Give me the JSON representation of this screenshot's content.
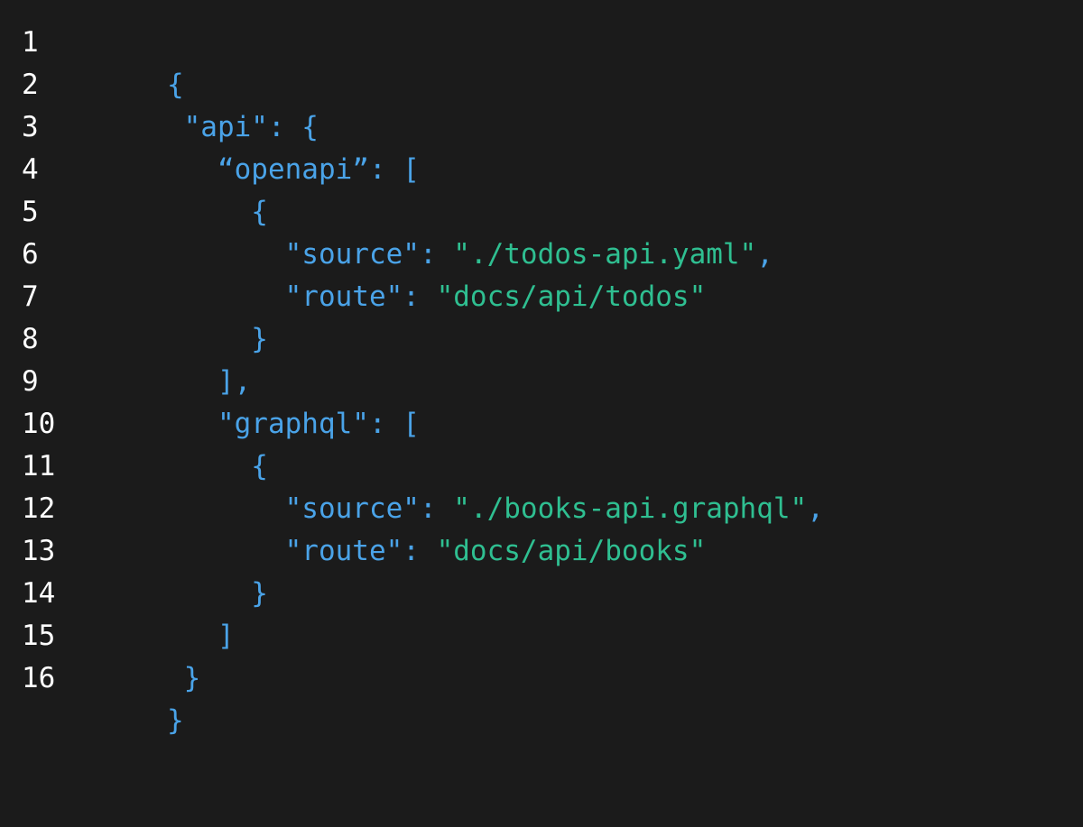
{
  "colors": {
    "background": "#1b1b1b",
    "line_number": "#ffffff",
    "key": "#4aa3e8",
    "punct": "#4aa3e8",
    "string": "#2fbf91"
  },
  "editor": {
    "lines": [
      {
        "number": "1",
        "tokens": [
          {
            "text": "{",
            "kind": "punct"
          }
        ]
      },
      {
        "number": "2",
        "tokens": [
          {
            "text": " \"api\"",
            "kind": "key"
          },
          {
            "text": ": {",
            "kind": "punct"
          }
        ]
      },
      {
        "number": "3",
        "tokens": [
          {
            "text": "   “openapi”",
            "kind": "key"
          },
          {
            "text": ": [",
            "kind": "punct"
          }
        ]
      },
      {
        "number": "4",
        "tokens": [
          {
            "text": "     {",
            "kind": "punct"
          }
        ]
      },
      {
        "number": "5",
        "tokens": [
          {
            "text": "       \"source\"",
            "kind": "key"
          },
          {
            "text": ": ",
            "kind": "punct"
          },
          {
            "text": "\"./todos-api.yaml\"",
            "kind": "string"
          },
          {
            "text": ",",
            "kind": "punct"
          }
        ]
      },
      {
        "number": "6",
        "tokens": [
          {
            "text": "       \"route\"",
            "kind": "key"
          },
          {
            "text": ": ",
            "kind": "punct"
          },
          {
            "text": "\"docs/api/todos\"",
            "kind": "string"
          }
        ]
      },
      {
        "number": "7",
        "tokens": [
          {
            "text": "     }",
            "kind": "punct"
          }
        ]
      },
      {
        "number": "8",
        "tokens": [
          {
            "text": "   ],",
            "kind": "punct"
          }
        ]
      },
      {
        "number": "9",
        "tokens": [
          {
            "text": "   \"graphql\"",
            "kind": "key"
          },
          {
            "text": ": [",
            "kind": "punct"
          }
        ]
      },
      {
        "number": "10",
        "tokens": [
          {
            "text": "     {",
            "kind": "punct"
          }
        ]
      },
      {
        "number": "11",
        "tokens": [
          {
            "text": "       \"source\"",
            "kind": "key"
          },
          {
            "text": ": ",
            "kind": "punct"
          },
          {
            "text": "\"./books-api.graphql\"",
            "kind": "string"
          },
          {
            "text": ",",
            "kind": "punct"
          }
        ]
      },
      {
        "number": "12",
        "tokens": [
          {
            "text": "       \"route\"",
            "kind": "key"
          },
          {
            "text": ": ",
            "kind": "punct"
          },
          {
            "text": "\"docs/api/books\"",
            "kind": "string"
          }
        ]
      },
      {
        "number": "13",
        "tokens": [
          {
            "text": "     }",
            "kind": "punct"
          }
        ]
      },
      {
        "number": "14",
        "tokens": [
          {
            "text": "   ]",
            "kind": "punct"
          }
        ]
      },
      {
        "number": "15",
        "tokens": [
          {
            "text": " }",
            "kind": "punct"
          }
        ]
      },
      {
        "number": "16",
        "tokens": [
          {
            "text": "}",
            "kind": "punct"
          }
        ]
      }
    ]
  }
}
